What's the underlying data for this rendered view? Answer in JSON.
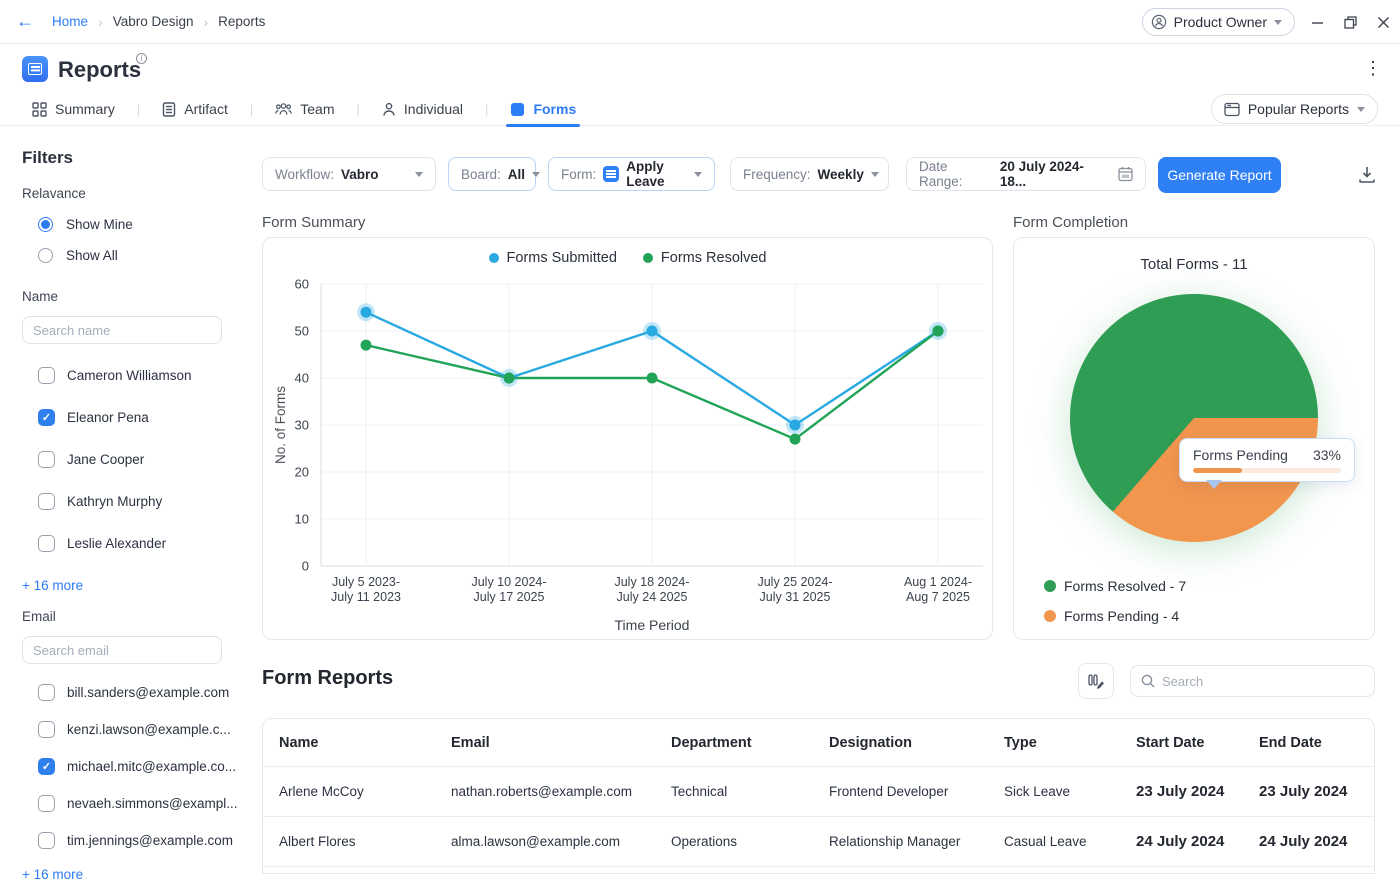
{
  "topbar": {
    "breadcrumb": [
      "Home",
      "Vabro Design",
      "Reports"
    ],
    "role_button": {
      "label": "Product Owner"
    }
  },
  "header": {
    "title": "Reports"
  },
  "tab_bar": {
    "tabs": [
      {
        "label": "Summary",
        "icon": "grid",
        "active": false
      },
      {
        "label": "Artifact",
        "icon": "document",
        "active": false
      },
      {
        "label": "Team",
        "icon": "team",
        "active": false
      },
      {
        "label": "Individual",
        "icon": "person",
        "active": false
      },
      {
        "label": "Forms",
        "icon": "form",
        "active": true
      }
    ],
    "popular_reports_label": "Popular Reports"
  },
  "sidebar": {
    "title": "Filters",
    "relevance": {
      "label": "Relavance",
      "options": [
        {
          "label": "Show Mine",
          "selected": true
        },
        {
          "label": "Show All",
          "selected": false
        }
      ]
    },
    "name_filter": {
      "label": "Name",
      "search_placeholder": "Search name",
      "items": [
        {
          "label": "Cameron Williamson",
          "checked": false
        },
        {
          "label": "Eleanor Pena",
          "checked": true
        },
        {
          "label": "Jane Cooper",
          "checked": false
        },
        {
          "label": "Kathryn Murphy",
          "checked": false
        },
        {
          "label": "Leslie Alexander",
          "checked": false
        }
      ],
      "more_label": "+ 16 more"
    },
    "email_filter": {
      "label": "Email",
      "search_placeholder": "Search email",
      "items": [
        {
          "label": "bill.sanders@example.com",
          "checked": false
        },
        {
          "label": "kenzi.lawson@example.c...",
          "checked": false
        },
        {
          "label": "michael.mitc@example.co...",
          "checked": true
        },
        {
          "label": "nevaeh.simmons@exampl...",
          "checked": false
        },
        {
          "label": "tim.jennings@example.com",
          "checked": false
        }
      ],
      "more_label": "+ 16 more"
    }
  },
  "filter_bar": {
    "workflow": {
      "label": "Workflow:",
      "value": "Vabro"
    },
    "board": {
      "label": "Board:",
      "value": "All"
    },
    "form": {
      "label": "Form:",
      "value": "Apply Leave"
    },
    "frequency": {
      "label": "Frequency:",
      "value": "Weekly"
    },
    "date_range": {
      "label": "Date Range:",
      "value": "20 July 2024- 18..."
    },
    "generate_label": "Generate Report"
  },
  "chart_data": [
    {
      "type": "line",
      "title": "Form Summary",
      "x": [
        "July 5 2023-\nJuly 11 2023",
        "July 10 2024-\nJuly 17 2025",
        "July 18 2024-\nJuly 24 2025",
        "July 25 2024-\nJuly 31 2025",
        "Aug 1 2024-\nAug 7 2025"
      ],
      "series": [
        {
          "name": "Forms Submitted",
          "color": "#29a9e1",
          "values": [
            54,
            40,
            50,
            30,
            50
          ]
        },
        {
          "name": "Forms Resolved",
          "color": "#21a457",
          "values": [
            47,
            40,
            40,
            27,
            50
          ]
        }
      ],
      "xlabel": "Time Period",
      "ylabel": "No. of Forms",
      "ylim": [
        0,
        60
      ],
      "yticks": [
        0,
        10,
        20,
        30,
        40,
        50,
        60
      ],
      "grid": true,
      "legend_position": "top"
    },
    {
      "type": "pie",
      "title": "Form Completion",
      "subtitle": "Total Forms - 11",
      "total_forms": 11,
      "slices": [
        {
          "label": "Forms Resolved",
          "value": 7,
          "color": "#2f9e54"
        },
        {
          "label": "Forms Pending",
          "value": 4,
          "color": "#f2964e"
        }
      ],
      "tooltip": {
        "label": "Forms Pending",
        "percent": "33%"
      },
      "legend": [
        {
          "label": "Forms Resolved - 7",
          "color": "#2f9e54"
        },
        {
          "label": "Forms Pending - 4",
          "color": "#f2964e"
        }
      ],
      "legend_position": "bottom-left"
    }
  ],
  "form_reports": {
    "title": "Form Reports",
    "search_placeholder": "Search",
    "table": {
      "headers": [
        "Name",
        "Email",
        "Department",
        "Designation",
        "Type",
        "Start Date",
        "End Date"
      ],
      "rows": [
        [
          "Arlene McCoy",
          "nathan.roberts@example.com",
          "Technical",
          "Frontend Developer",
          "Sick Leave",
          "23 July 2024",
          "23 July 2024"
        ],
        [
          "Albert Flores",
          "alma.lawson@example.com",
          "Operations",
          "Relationship Manager",
          "Casual Leave",
          "24 July 2024",
          "24 July 2024"
        ]
      ]
    }
  },
  "colors": {
    "accent_blue": "#2b7cf5",
    "line_blue": "#29a9e1",
    "line_green": "#21a457",
    "pie_green": "#2f9e54",
    "pie_orange": "#f2964e"
  }
}
